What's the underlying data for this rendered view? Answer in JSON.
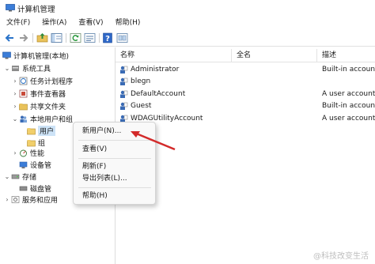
{
  "window": {
    "title": "计算机管理"
  },
  "menubar": [
    {
      "id": "file",
      "label": "文件(F)"
    },
    {
      "id": "action",
      "label": "操作(A)"
    },
    {
      "id": "view",
      "label": "查看(V)"
    },
    {
      "id": "help",
      "label": "帮助(H)"
    }
  ],
  "toolbar": {
    "icons": [
      "back-arrow-icon",
      "forward-arrow-icon",
      "up-folder-icon",
      "console-tree-icon",
      "refresh-icon",
      "export-list-icon",
      "help-icon",
      "properties-icon"
    ]
  },
  "tree": {
    "root": "计算机管理(本地)",
    "system_tools": "系统工具",
    "task_scheduler": "任务计划程序",
    "event_viewer": "事件查看器",
    "shared_folders": "共享文件夹",
    "local_users_groups": "本地用户和组",
    "users": "用户",
    "groups": "组",
    "performance": "性能",
    "device_manager": "设备管",
    "storage": "存储",
    "disk_management": "磁盘管",
    "services_apps": "服务和应用"
  },
  "table": {
    "headers": [
      "名称",
      "全名",
      "描述"
    ],
    "rows": [
      {
        "name": "Administrator",
        "full_name": "",
        "description": "Built-in accoun"
      },
      {
        "name": "blegn",
        "full_name": "",
        "description": ""
      },
      {
        "name": "DefaultAccount",
        "full_name": "",
        "description": "A user account"
      },
      {
        "name": "Guest",
        "full_name": "",
        "description": "Built-in accoun"
      },
      {
        "name": "WDAGUtilityAccount",
        "full_name": "",
        "description": "A user account"
      }
    ]
  },
  "context_menu": {
    "new_user": "新用户(N)...",
    "view": "查看(V)",
    "refresh": "刷新(F)",
    "export": "导出列表(L)...",
    "help": "帮助(H)"
  },
  "annotation": {
    "arrow_color": "#d32a2a"
  },
  "watermark": {
    "text": "@科技改变生活"
  }
}
